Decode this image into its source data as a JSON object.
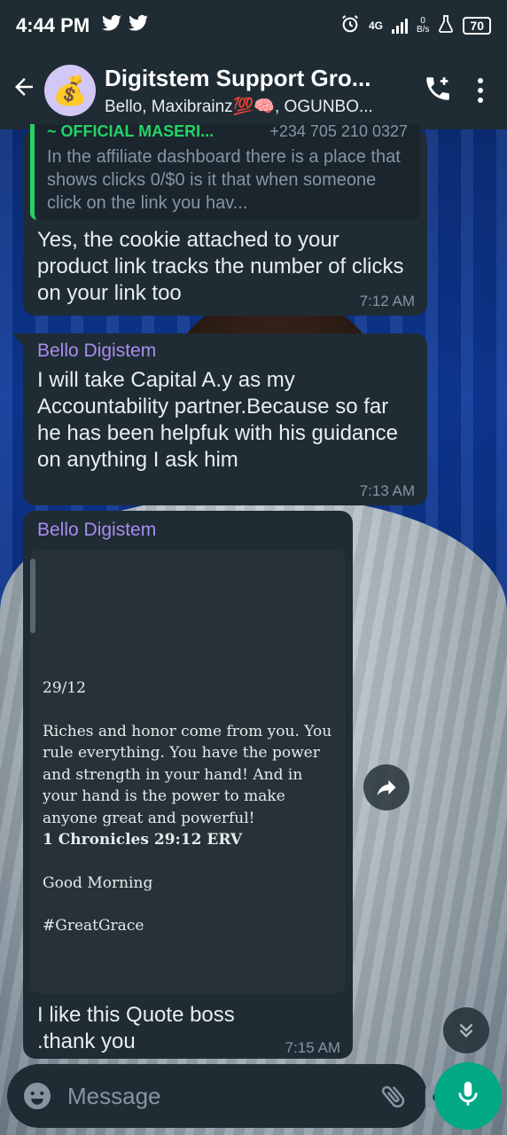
{
  "status_bar": {
    "time": "4:44 PM",
    "network": "4G",
    "speed_value": "0",
    "speed_unit": "B/s",
    "battery": "70"
  },
  "header": {
    "group_name": "Digitstem Support Gro...",
    "members": "Bello, Maxibrainz💯🧠, OGUNBO...",
    "avatar_emoji": "💰"
  },
  "messages": [
    {
      "quoted": {
        "author": "~ OFFICIAL MASERI...",
        "phone": "+234 705 210 0327",
        "text": "In the affiliate dashboard  there is a place that shows clicks  0/$0 is it that when someone click on the link you hav..."
      },
      "text": "Yes, the cookie attached to your product link tracks the number of clicks on your link too",
      "time": "7:12 AM"
    },
    {
      "sender": "Bello Digistem",
      "text": "I will take Capital A.y as my Accountability partner.Because so far he has been helpfuk with his guidance on anything I ask him",
      "time": "7:13 AM"
    },
    {
      "sender": "Bello Digistem",
      "image": {
        "date": "29/12",
        "verse": "Riches and honor come from you. You rule everything. You have the power and strength in your hand! And in your hand is the power to make anyone great and powerful!",
        "reference": "1 Chronicles 29:12 ERV",
        "greeting": "Good Morning",
        "hashtag": "#GreatGrace"
      },
      "text": "I like this Quote boss .thank you",
      "time": "7:15 AM"
    }
  ],
  "input": {
    "placeholder": "Message"
  },
  "colors": {
    "header": "#1f2c34",
    "bubble": "#1f2c34",
    "accent_green": "#00a884",
    "sender_purple": "#a98cf0",
    "quote_green": "#25d366"
  },
  "icons": [
    "twitter-icon",
    "alarm-icon",
    "back-arrow-icon",
    "add-call-icon",
    "more-vert-icon",
    "forward-icon",
    "chevrons-down-icon",
    "emoji-icon",
    "attach-icon",
    "camera-icon",
    "mic-icon"
  ]
}
